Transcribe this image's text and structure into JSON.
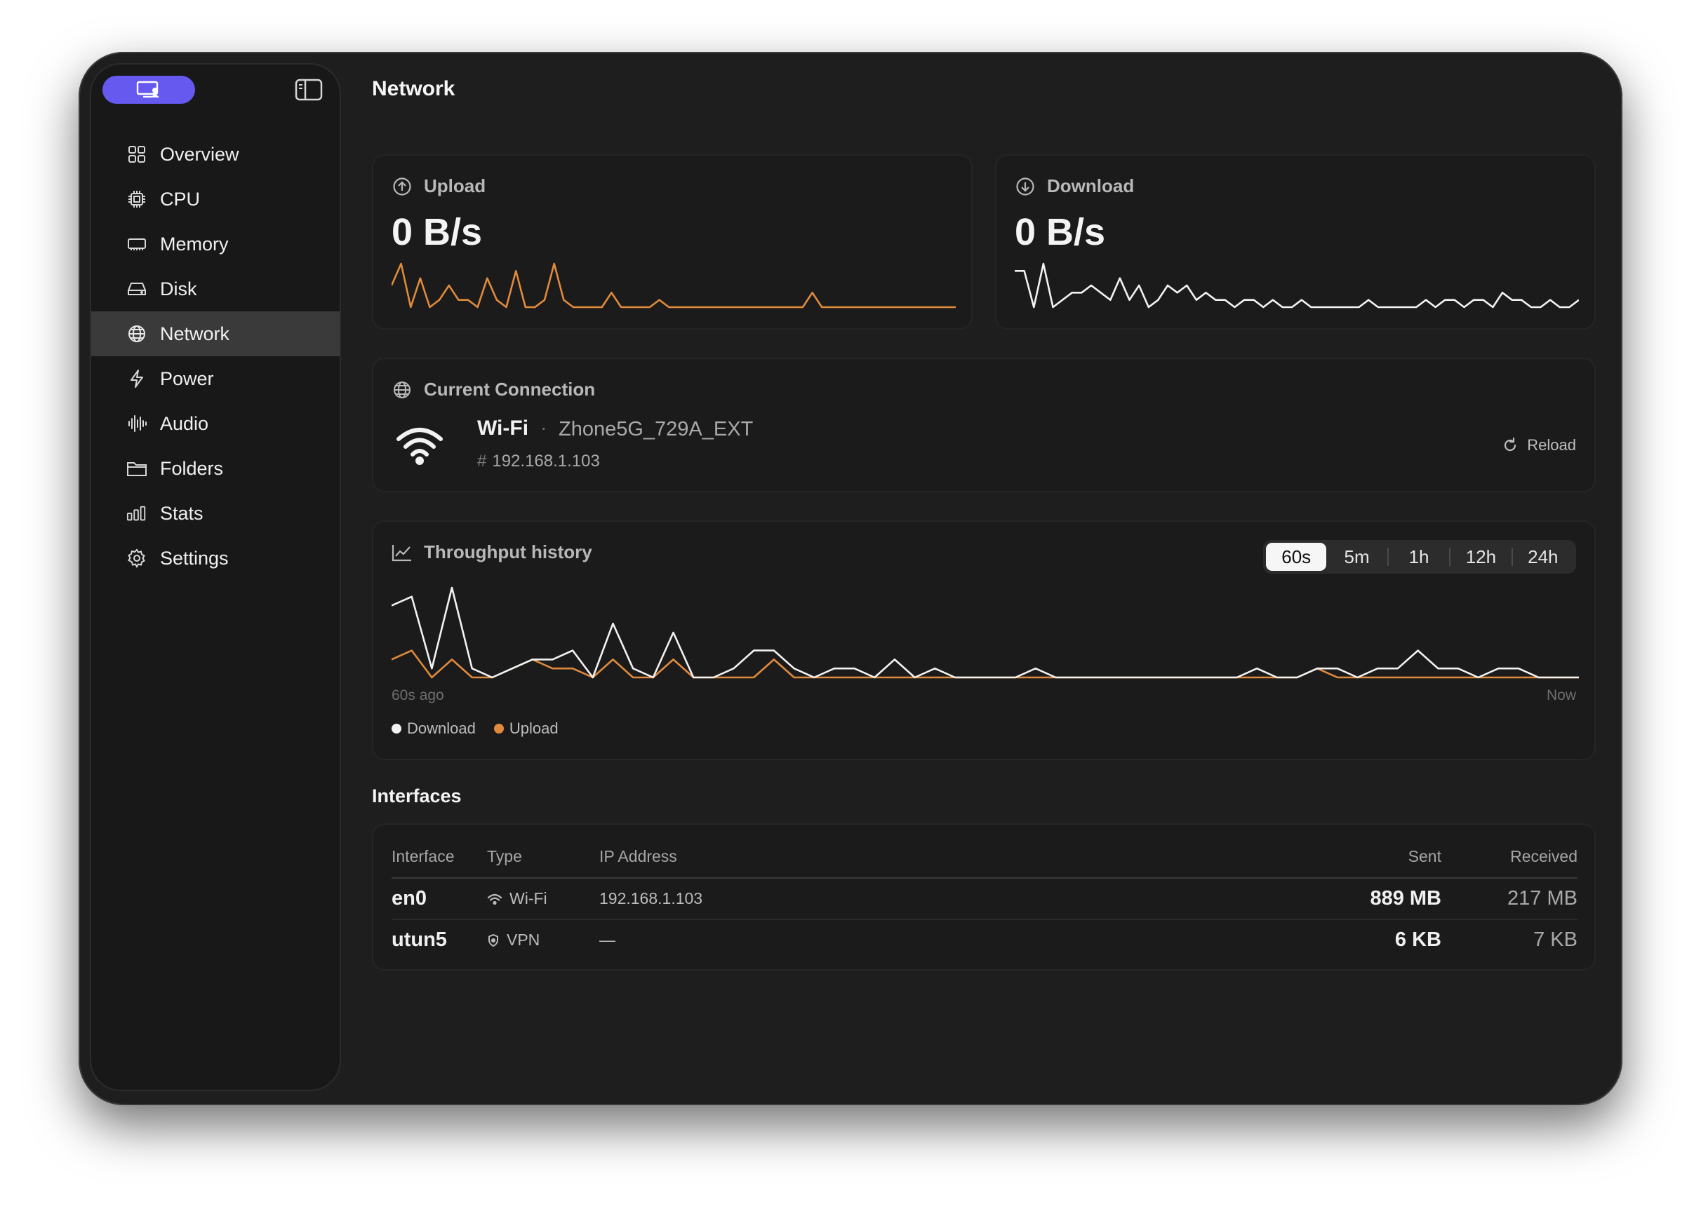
{
  "sidebar": {
    "items": [
      {
        "label": "Overview",
        "icon": "grid-icon"
      },
      {
        "label": "CPU",
        "icon": "chip-icon"
      },
      {
        "label": "Memory",
        "icon": "memory-icon"
      },
      {
        "label": "Disk",
        "icon": "disk-icon"
      },
      {
        "label": "Network",
        "icon": "globe-icon",
        "active": true
      },
      {
        "label": "Power",
        "icon": "bolt-icon"
      },
      {
        "label": "Audio",
        "icon": "waveform-icon"
      },
      {
        "label": "Folders",
        "icon": "folder-icon"
      },
      {
        "label": "Stats",
        "icon": "bars-icon"
      },
      {
        "label": "Settings",
        "icon": "gear-icon"
      }
    ]
  },
  "page": {
    "title": "Network"
  },
  "upload": {
    "label": "Upload",
    "value": "0 B/s",
    "color": "#e08a3c",
    "spark": [
      3,
      6,
      0,
      4,
      0,
      1,
      3,
      1,
      1,
      0,
      4,
      1,
      0,
      5,
      0,
      0,
      1,
      6,
      1,
      0,
      0,
      0,
      0,
      2,
      0,
      0,
      0,
      0,
      1,
      0,
      0,
      0,
      0,
      0,
      0,
      0,
      0,
      0,
      0,
      0,
      0,
      0,
      0,
      0,
      2,
      0,
      0,
      0,
      0,
      0,
      0,
      0,
      0,
      0,
      0,
      0,
      0,
      0,
      0,
      0
    ]
  },
  "download": {
    "label": "Download",
    "value": "0 B/s",
    "color": "#f2f2f2",
    "spark": [
      5,
      5,
      0,
      6,
      0,
      1,
      2,
      2,
      3,
      2,
      1,
      4,
      1,
      3,
      0,
      1,
      3,
      2,
      3,
      1,
      2,
      1,
      1,
      0,
      1,
      1,
      0,
      1,
      0,
      0,
      1,
      0,
      0,
      0,
      0,
      0,
      0,
      1,
      0,
      0,
      0,
      0,
      0,
      1,
      0,
      1,
      1,
      0,
      1,
      1,
      0,
      2,
      1,
      1,
      0,
      0,
      1,
      0,
      0,
      1
    ]
  },
  "connection": {
    "title": "Current Connection",
    "type": "Wi-Fi",
    "separator": "·",
    "ssid": "Zhone5G_729A_EXT",
    "ip": "192.168.1.103",
    "ip_prefix": "#",
    "reload_label": "Reload"
  },
  "throughput": {
    "title": "Throughput history",
    "ranges": [
      "60s",
      "5m",
      "1h",
      "12h",
      "24h"
    ],
    "selected_range": "60s",
    "axis_start": "60s ago",
    "axis_end": "Now",
    "legend": {
      "download": "Download",
      "upload": "Upload"
    }
  },
  "chart_data": {
    "type": "line",
    "title": "Throughput history",
    "x": [
      "60s ago",
      "",
      "",
      "",
      "",
      "",
      "",
      "",
      "",
      "",
      "",
      "",
      "",
      "",
      "",
      "",
      "",
      "",
      "",
      "",
      "",
      "",
      "",
      "",
      "",
      "",
      "",
      "",
      "",
      "",
      "",
      "",
      "",
      "",
      "",
      "",
      "",
      "",
      "",
      "",
      "",
      "",
      "",
      "",
      "",
      "",
      "",
      "",
      "",
      "",
      "",
      "",
      "",
      "",
      "",
      "",
      "",
      "",
      "",
      "Now"
    ],
    "series": [
      {
        "name": "Download",
        "color": "#f2f2f2",
        "values": [
          8,
          9,
          1,
          10,
          1,
          0,
          1,
          2,
          2,
          3,
          0,
          6,
          1,
          0,
          5,
          0,
          0,
          1,
          3,
          3,
          1,
          0,
          1,
          1,
          0,
          2,
          0,
          1,
          0,
          0,
          0,
          0,
          1,
          0,
          0,
          0,
          0,
          0,
          0,
          0,
          0,
          0,
          0,
          1,
          0,
          0,
          1,
          1,
          0,
          1,
          1,
          3,
          1,
          1,
          0,
          1,
          1,
          0,
          0,
          0
        ]
      },
      {
        "name": "Upload",
        "color": "#e08a3c",
        "values": [
          2,
          3,
          0,
          2,
          0,
          0,
          1,
          2,
          1,
          1,
          0,
          2,
          0,
          0,
          2,
          0,
          0,
          0,
          0,
          2,
          0,
          0,
          0,
          0,
          0,
          0,
          0,
          0,
          0,
          0,
          0,
          0,
          0,
          0,
          0,
          0,
          0,
          0,
          0,
          0,
          0,
          0,
          0,
          0,
          0,
          0,
          1,
          0,
          0,
          0,
          0,
          0,
          0,
          0,
          0,
          0,
          0,
          0,
          0,
          0
        ]
      }
    ]
  },
  "interfaces": {
    "title": "Interfaces",
    "columns": [
      "Interface",
      "Type",
      "IP Address",
      "Sent",
      "Received"
    ],
    "rows": [
      {
        "name": "en0",
        "type": "Wi-Fi",
        "type_icon": "wifi-icon",
        "ip": "192.168.1.103",
        "sent": "889 MB",
        "received": "217 MB"
      },
      {
        "name": "utun5",
        "type": "VPN",
        "type_icon": "shield-icon",
        "ip": "—",
        "sent": "6 KB",
        "received": "7 KB"
      }
    ]
  }
}
